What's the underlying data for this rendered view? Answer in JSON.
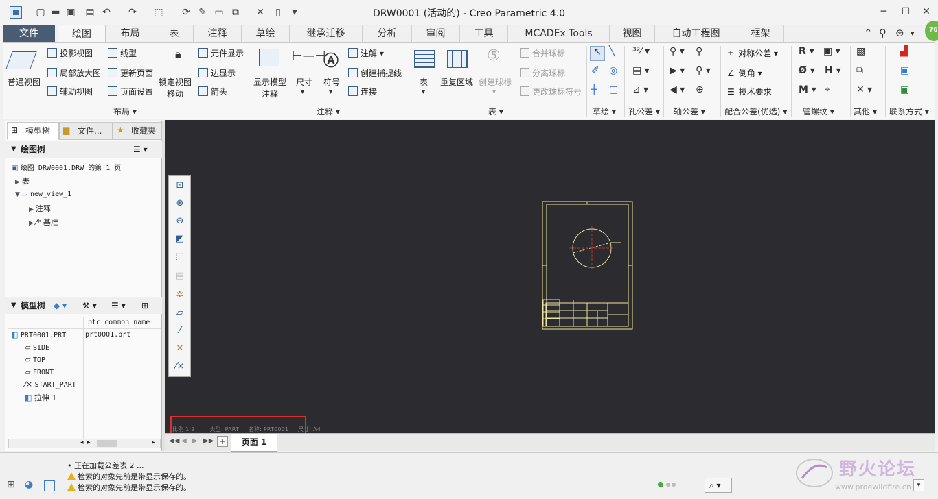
{
  "window": {
    "title": "DRW0001 (活动的) - Creo Parametric 4.0"
  },
  "ribbon_tabs": [
    {
      "label": "文件"
    },
    {
      "label": "绘图"
    },
    {
      "label": "布局"
    },
    {
      "label": "表"
    },
    {
      "label": "注释"
    },
    {
      "label": "草绘"
    },
    {
      "label": "继承迁移"
    },
    {
      "label": "分析"
    },
    {
      "label": "审阅"
    },
    {
      "label": "工具"
    },
    {
      "label": "MCADEx Tools"
    },
    {
      "label": "视图"
    },
    {
      "label": "自动工程图"
    },
    {
      "label": "框架"
    }
  ],
  "active_tab": "绘图",
  "user_badge": "76",
  "ribbon": {
    "layout": {
      "label": "布局",
      "normal_view": "普通视图",
      "projection_view": "投影视图",
      "detailed_view": "局部放大图",
      "auxiliary_view": "辅助视图",
      "line_style": "线型",
      "update_sheets": "更新页面",
      "page_setup": "页面设置",
      "lock_view_move_1": "锁定视图",
      "lock_view_move_2": "移动",
      "element_display": "元件显示",
      "edge_display": "边显示",
      "arrows": "箭头"
    },
    "annotate": {
      "label": "注释",
      "show_model_1": "显示模型",
      "show_model_2": "注释",
      "dimension": "尺寸",
      "symbol": "符号",
      "note": "注解",
      "create_snap_line": "创建捕捉线",
      "connect": "连接"
    },
    "table": {
      "label": "表",
      "table": "表",
      "repeat_region": "重复区域",
      "create_balloon": "创建球标",
      "merge_balloons": "合并球标",
      "detach_balloons": "分离球标",
      "change_balloon_symbol": "更改球标符号"
    },
    "sketch": {
      "label": "草绘"
    },
    "hole_tol": {
      "label": "孔公差"
    },
    "shaft_tol": {
      "label": "轴公差"
    },
    "fit_tol": {
      "label": "配合公差(优选)",
      "symmetric_tol": "对称公差",
      "chamfer": "倒角",
      "tech_req": "技术要求"
    },
    "pipe_thread": {
      "label": "管螺纹"
    },
    "other": {
      "label": "其他"
    },
    "contact": {
      "label": "联系方式"
    }
  },
  "left_panel": {
    "tabs": [
      {
        "label": "模型树"
      },
      {
        "label": "文件..."
      },
      {
        "label": "收藏夹"
      }
    ],
    "drawing_tree": {
      "title": "绘图树",
      "root": "绘图 DRW0001.DRW 的第 1 页",
      "items": [
        "表",
        "new_view_1",
        "注释",
        "基准"
      ]
    },
    "model_tree": {
      "title": "模型树",
      "column": "ptc_common_name",
      "rows": [
        {
          "name": "PRT0001.PRT",
          "value": "prt0001.prt"
        },
        {
          "name": "SIDE",
          "value": ""
        },
        {
          "name": "TOP",
          "value": ""
        },
        {
          "name": "FRONT",
          "value": ""
        },
        {
          "name": "START_PART",
          "value": ""
        },
        {
          "name": "拉伸 1",
          "value": ""
        }
      ]
    }
  },
  "canvas": {
    "info": {
      "scale": "比例 1:2",
      "type": "类型: PART",
      "name": "名称: PRT0001",
      "size": "尺寸: A4"
    }
  },
  "sheet": {
    "label": "页面 1"
  },
  "messages": [
    {
      "text": "• 正在加载公差表 2 ..."
    },
    {
      "text": "检索的对象先前是带显示保存的。"
    },
    {
      "text": "检索的对象先前是带显示保存的。"
    }
  ],
  "watermark": {
    "title": "野火论坛",
    "url": "www.proewildfire.cn"
  },
  "colors": {
    "canvas_bg": "#2b2b30",
    "drawing_lines": "#ece7a2",
    "highlight": "#e0302c",
    "file_tab": "#4a5c73"
  }
}
